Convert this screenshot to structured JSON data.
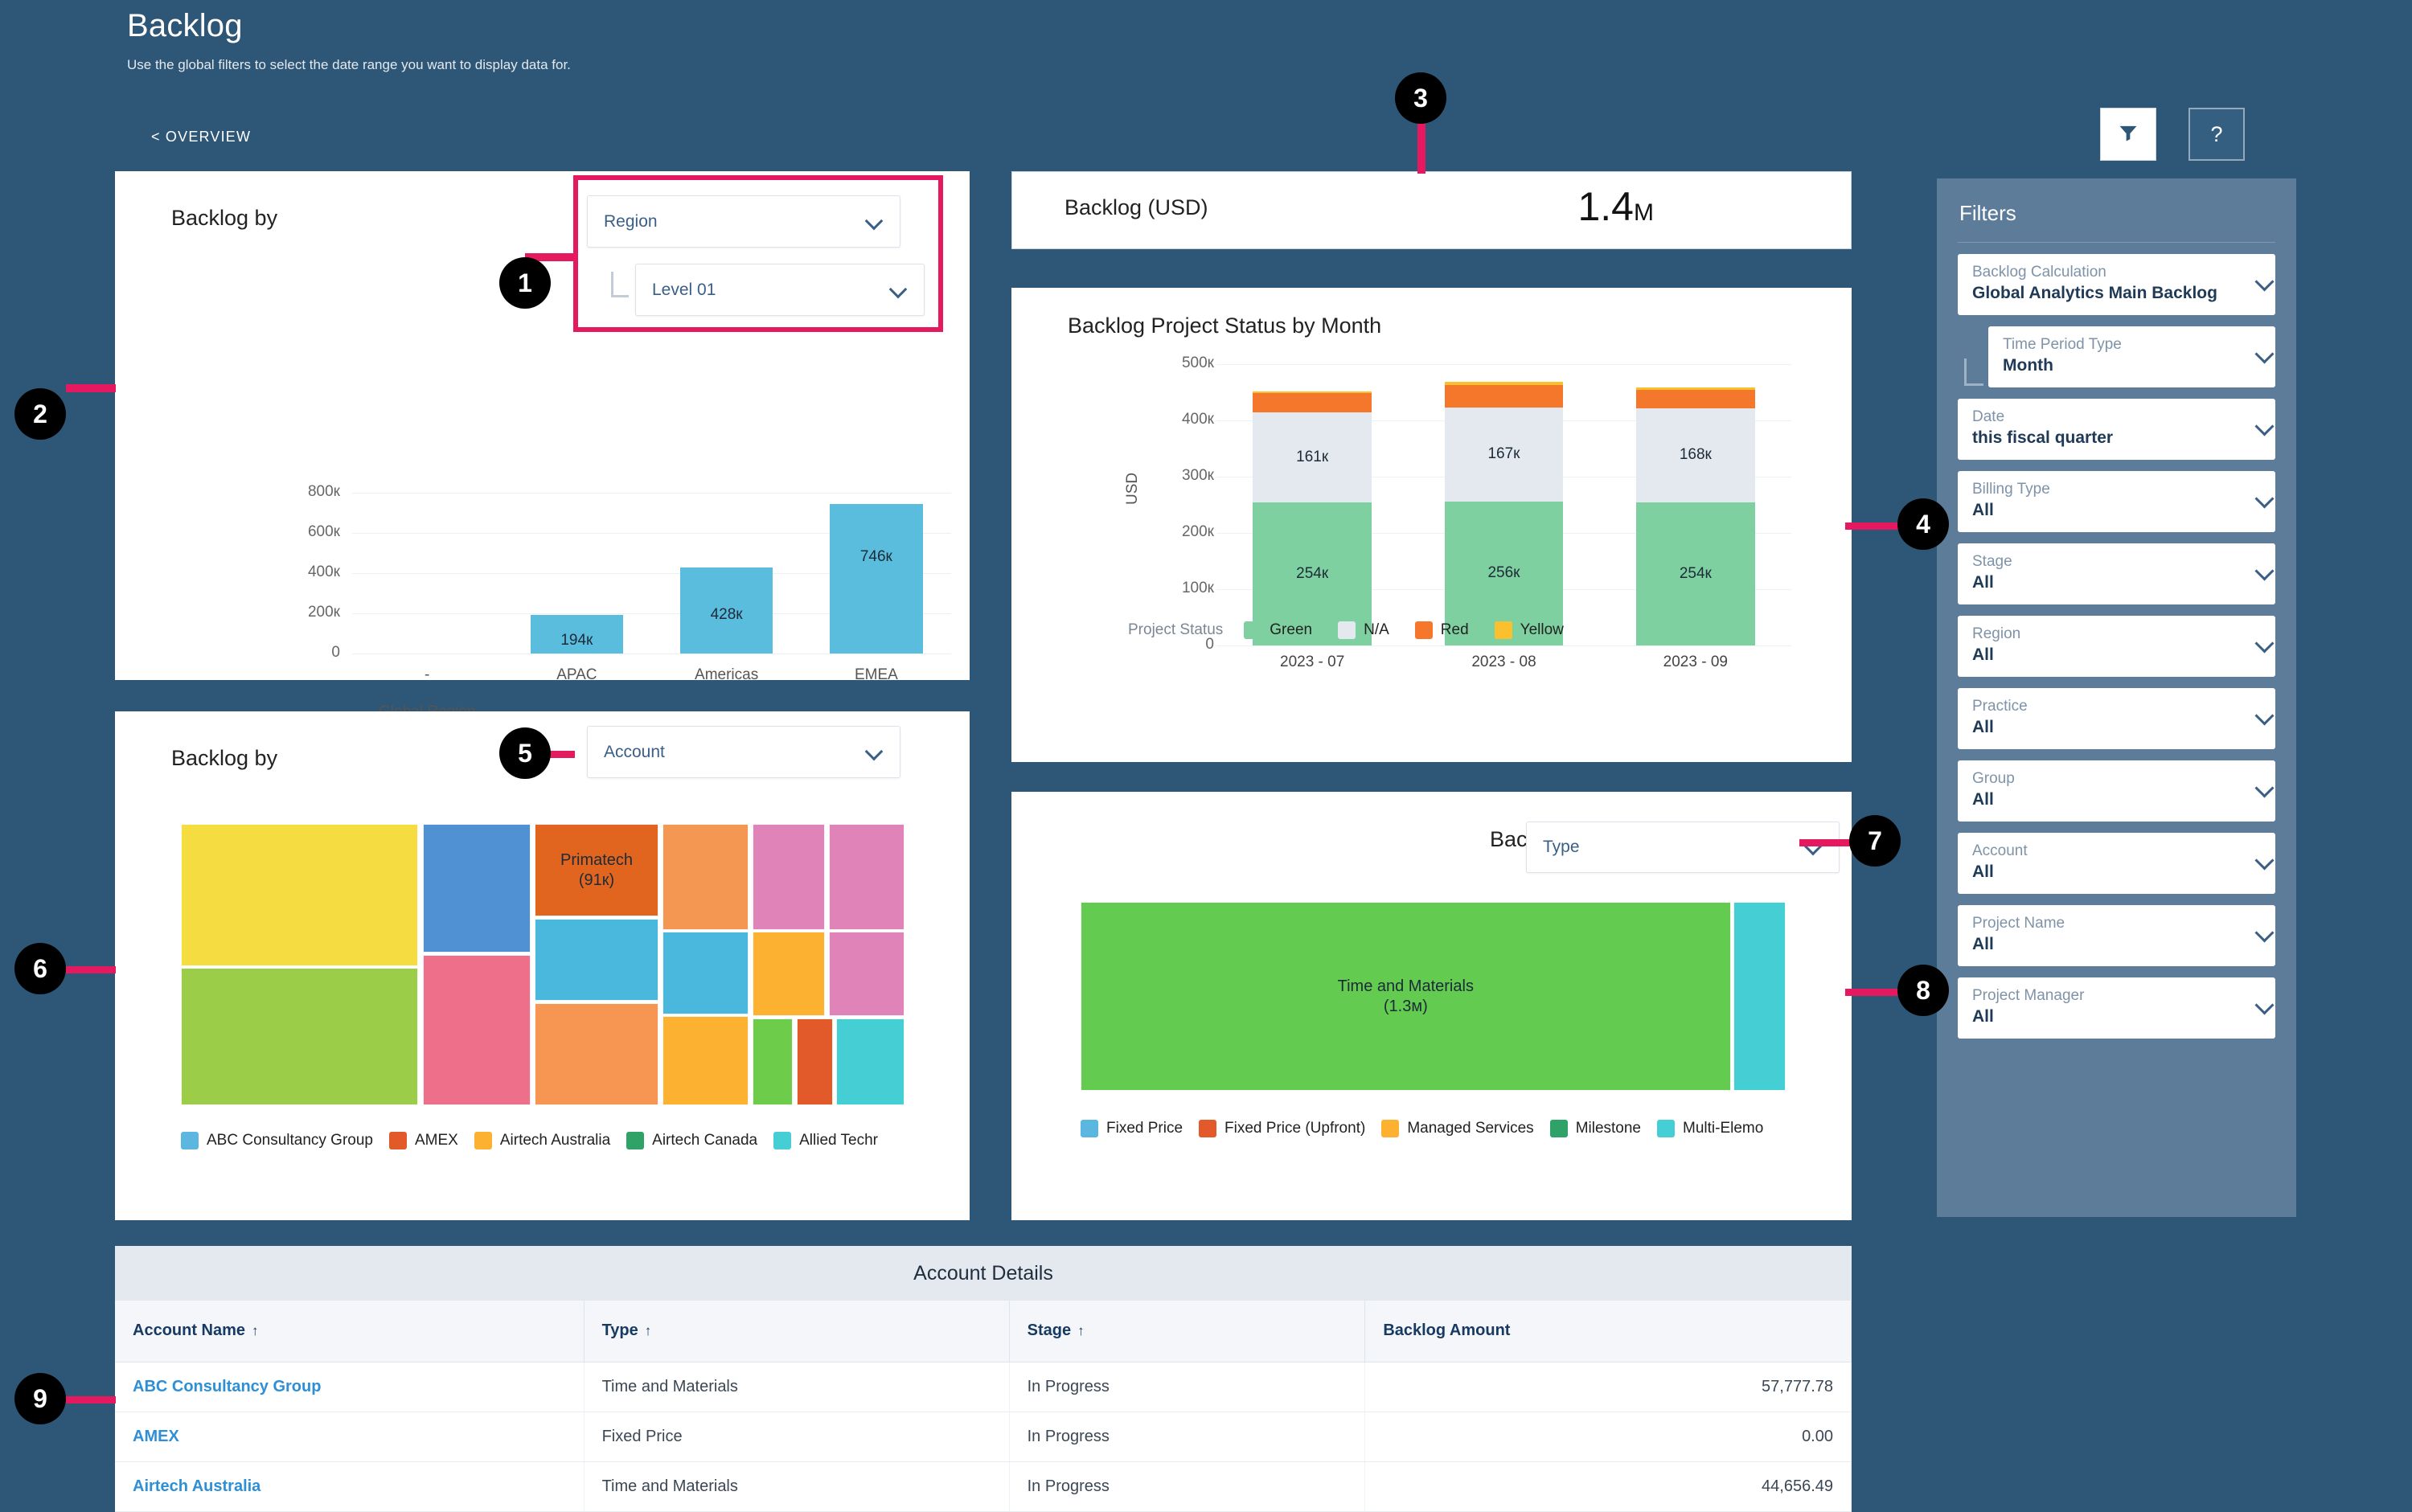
{
  "page": {
    "title": "Backlog",
    "subtitle": "Use the global filters to select the date range you want to display data for.",
    "overview_link": "< OVERVIEW",
    "filter_button_icon": "funnel-icon",
    "help_button_label": "?"
  },
  "region_card": {
    "title": "Backlog by",
    "dimension_select": "Region",
    "level_select": "Level 01"
  },
  "kpi": {
    "label": "Backlog (USD)",
    "value": "1.4",
    "value_suffix": "M"
  },
  "status_card": {
    "title": "Backlog Project Status by Month"
  },
  "account_card": {
    "title": "Backlog by",
    "dimension_select": "Account",
    "highlight_label": "Primatech",
    "highlight_value": "(91к)"
  },
  "type_card": {
    "title": "Backlog by",
    "dimension_select": "Type",
    "highlight_label": "Time and Materials",
    "highlight_value": "(1.3м)"
  },
  "table": {
    "caption": "Account Details",
    "columns": [
      "Account Name",
      "Type",
      "Stage",
      "Backlog Amount"
    ],
    "sort_indicators": [
      "↑",
      "↑",
      "↑",
      ""
    ],
    "rows": [
      {
        "account": "ABC Consultancy Group",
        "type": "Time and Materials",
        "stage": "In Progress",
        "amount": "57,777.78"
      },
      {
        "account": "AMEX",
        "type": "Fixed Price",
        "stage": "In Progress",
        "amount": "0.00"
      },
      {
        "account": "Airtech Australia",
        "type": "Time and Materials",
        "stage": "In Progress",
        "amount": "44,656.49"
      }
    ]
  },
  "filters": {
    "title": "Filters",
    "items": [
      {
        "label": "Backlog Calculation",
        "value": "Global Analytics Main Backlog",
        "indented": false
      },
      {
        "label": "Time Period Type",
        "value": "Month",
        "indented": true
      },
      {
        "label": "Date",
        "value": "this fiscal quarter",
        "indented": false
      },
      {
        "label": "Billing Type",
        "value": "All",
        "indented": false
      },
      {
        "label": "Stage",
        "value": "All",
        "indented": false
      },
      {
        "label": "Region",
        "value": "All",
        "indented": false
      },
      {
        "label": "Practice",
        "value": "All",
        "indented": false
      },
      {
        "label": "Group",
        "value": "All",
        "indented": false
      },
      {
        "label": "Account",
        "value": "All",
        "indented": false
      },
      {
        "label": "Project Name",
        "value": "All",
        "indented": false
      },
      {
        "label": "Project Manager",
        "value": "All",
        "indented": false
      }
    ]
  },
  "callouts": [
    {
      "n": "1"
    },
    {
      "n": "2"
    },
    {
      "n": "3"
    },
    {
      "n": "4"
    },
    {
      "n": "5"
    },
    {
      "n": "6"
    },
    {
      "n": "7"
    },
    {
      "n": "8"
    },
    {
      "n": "9"
    }
  ],
  "colors": {
    "page_bg": "#2e5676",
    "filters_bg": "#5d7c99",
    "accent_pink": "#e4195f",
    "bar_blue": "#5bbddd",
    "status_green": "#7ed0a0",
    "status_na": "#e4e8ef",
    "status_red": "#f4772c",
    "status_yellow": "#fbc02d",
    "link_blue": "#2d8fd5"
  },
  "chart_data": [
    {
      "type": "bar",
      "title": "Backlog by Region",
      "xlabel": "Global Region",
      "ylabel": "",
      "categories": [
        "-",
        "APAC",
        "Americas",
        "EMEA"
      ],
      "values": [
        0,
        194000,
        428000,
        746000
      ],
      "value_labels": [
        "",
        "194к",
        "428к",
        "746к"
      ],
      "ytick_labels": [
        "0",
        "200к",
        "400к",
        "600к",
        "800к"
      ],
      "yticks": [
        0,
        200000,
        400000,
        600000,
        800000
      ],
      "ylim": [
        0,
        800000
      ],
      "grid": true,
      "series_color": "#5bbddd"
    },
    {
      "type": "bar",
      "subtype": "stacked",
      "title": "Backlog Project Status by Month",
      "xlabel": "",
      "ylabel": "USD",
      "categories": [
        "2023 - 07",
        "2023 - 08",
        "2023 - 09"
      ],
      "ytick_labels": [
        "0",
        "100к",
        "200к",
        "300к",
        "400к",
        "500к"
      ],
      "yticks": [
        0,
        100000,
        200000,
        300000,
        400000,
        500000
      ],
      "ylim": [
        0,
        500000
      ],
      "grid": true,
      "legend_title": "Project Status",
      "legend_position": "bottom",
      "series": [
        {
          "name": "Green",
          "color": "#7ed0a0",
          "values": [
            254000,
            256000,
            254000
          ],
          "labels": [
            "254к",
            "256к",
            "254к"
          ]
        },
        {
          "name": "N/A",
          "color": "#e4e8ef",
          "values": [
            161000,
            167000,
            168000
          ],
          "labels": [
            "161к",
            "167к",
            "168к"
          ]
        },
        {
          "name": "Red",
          "color": "#f4772c",
          "values": [
            33000,
            40000,
            32000
          ],
          "labels": [
            "",
            "",
            ""
          ]
        },
        {
          "name": "Yellow",
          "color": "#fbc02d",
          "values": [
            4000,
            6000,
            5000
          ],
          "labels": [
            "",
            "",
            ""
          ]
        }
      ]
    },
    {
      "type": "treemap",
      "title": "Backlog by Account",
      "legend_position": "bottom",
      "legend": [
        {
          "name": "ABC Consultancy Group",
          "color": "#5bb7e0"
        },
        {
          "name": "AMEX",
          "color": "#e2592a"
        },
        {
          "name": "Airtech Australia",
          "color": "#fcb131"
        },
        {
          "name": "Airtech Canada",
          "color": "#2fa268"
        },
        {
          "name": "Allied Techr",
          "color": "#45cfd4"
        }
      ],
      "tiles": [
        {
          "label": "",
          "value": null,
          "color": "#f4dc41",
          "x": 0,
          "y": 0,
          "w": 32.8,
          "h": 50.5
        },
        {
          "label": "",
          "value": null,
          "color": "#9ccd49",
          "x": 0,
          "y": 51.2,
          "w": 32.8,
          "h": 48.8
        },
        {
          "label": "",
          "value": null,
          "color": "#5091d4",
          "x": 33.4,
          "y": 0,
          "w": 14.9,
          "h": 45.8
        },
        {
          "label": "",
          "value": null,
          "color": "#ed6f89",
          "x": 33.4,
          "y": 46.5,
          "w": 14.9,
          "h": 53.5
        },
        {
          "label": "Primatech",
          "value": "(91к)",
          "color": "#e2651f",
          "x": 48.9,
          "y": 0,
          "w": 17.1,
          "h": 32.9
        },
        {
          "label": "",
          "value": null,
          "color": "#4ab8dd",
          "x": 48.9,
          "y": 33.6,
          "w": 17.1,
          "h": 29.3
        },
        {
          "label": "",
          "value": null,
          "color": "#f79552",
          "x": 48.9,
          "y": 63.6,
          "w": 17.1,
          "h": 36.4
        },
        {
          "label": "",
          "value": null,
          "color": "#f49752",
          "x": 66.6,
          "y": 0,
          "w": 11.8,
          "h": 37.6
        },
        {
          "label": "",
          "value": null,
          "color": "#4ab8dd",
          "x": 66.6,
          "y": 38.3,
          "w": 11.8,
          "h": 29.4
        },
        {
          "label": "",
          "value": null,
          "color": "#fcb131",
          "x": 66.6,
          "y": 68.4,
          "w": 11.8,
          "h": 31.6
        },
        {
          "label": "",
          "value": null,
          "color": "#e083b8",
          "x": 79.0,
          "y": 0,
          "w": 10.0,
          "h": 37.6
        },
        {
          "label": "",
          "value": null,
          "color": "#fcb131",
          "x": 79.0,
          "y": 38.3,
          "w": 10.0,
          "h": 30.1
        },
        {
          "label": "",
          "value": null,
          "color": "#6ecc4b",
          "x": 79.0,
          "y": 69.1,
          "w": 5.5,
          "h": 30.9
        },
        {
          "label": "",
          "value": null,
          "color": "#e2592a",
          "x": 85.1,
          "y": 69.1,
          "w": 5.0,
          "h": 30.9
        },
        {
          "label": "",
          "value": null,
          "color": "#e083b8",
          "x": 89.6,
          "y": 0,
          "w": 10.4,
          "h": 37.6
        },
        {
          "label": "",
          "value": null,
          "color": "#e083b8",
          "x": 89.6,
          "y": 38.3,
          "w": 10.4,
          "h": 30.1
        },
        {
          "label": "",
          "value": null,
          "color": "#45cfd4",
          "x": 90.6,
          "y": 69.1,
          "w": 9.4,
          "h": 30.9
        }
      ]
    },
    {
      "type": "treemap",
      "title": "Backlog by Type",
      "legend_position": "bottom",
      "legend": [
        {
          "name": "Fixed Price",
          "color": "#5bb7e0"
        },
        {
          "name": "Fixed Price (Upfront)",
          "color": "#e2592a"
        },
        {
          "name": "Managed Services",
          "color": "#fcb131"
        },
        {
          "name": "Milestone",
          "color": "#2fa268"
        },
        {
          "name": "Multi-Elemo",
          "color": "#45cfd4"
        }
      ],
      "tiles": [
        {
          "label": "Time and Materials",
          "value": "(1.3м)",
          "color": "#63cb4f",
          "x": 0,
          "y": 0,
          "w": 92.2,
          "h": 100
        },
        {
          "label": "",
          "value": null,
          "color": "#45cfd4",
          "x": 92.6,
          "y": 0,
          "w": 7.4,
          "h": 100
        }
      ]
    }
  ]
}
